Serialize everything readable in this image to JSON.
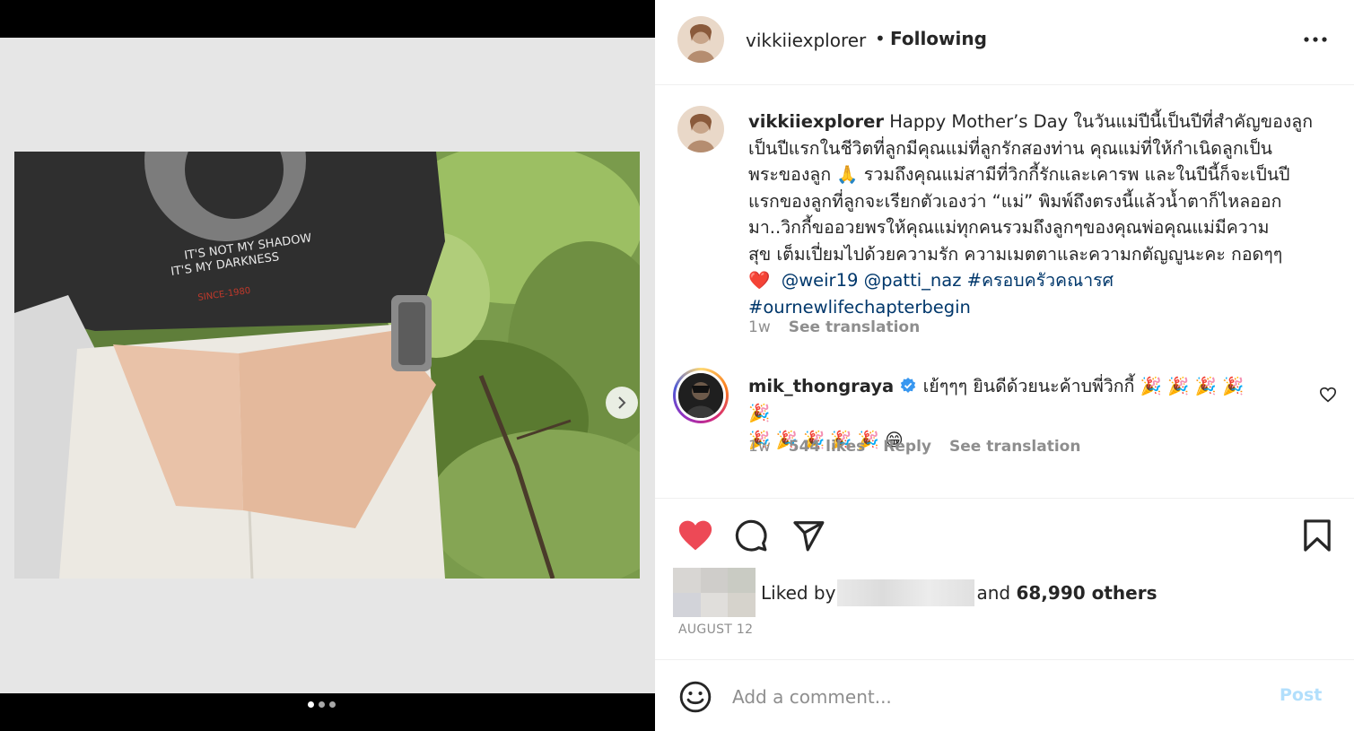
{
  "post": {
    "username": "vikkiiexplorer",
    "separator": "•",
    "follow_status": "Following",
    "more_icon": "more-horizontal-icon"
  },
  "caption": {
    "username": "vikkiiexplorer",
    "lines": [
      "Happy Mother’s Day ในวันแม่ปีนี้เป็นปีที่สำคัญของลูก",
      "เป็นปีแรกในชีวิตที่ลูกมีคุณแม่ที่ลูกรักสองท่าน คุณแม่ที่ให้กำเนิดลูกเป็น",
      "พระของลูก 🙏 รวมถึงคุณแม่สามีที่วิกกี้รักและเคารพ และในปีนี้ก็จะเป็นปี",
      "แรกของลูกที่ลูกจะเรียกตัวเองว่า “แม่” พิมพ์ถึงตรงนี้แล้วน้ำตาก็ไหลออก",
      "มา..วิกกี้ขออวยพรให้คุณแม่ทุกคนรวมถึงลูกๆของคุณพ่อคุณแม่มีความ",
      "สุข เต็มเปี่ยมไปด้วยความรัก ความเมตตาและความกตัญญูนะคะ กอดๆๆ"
    ],
    "heart": "❤️",
    "mentions": [
      "@weir19",
      "@patti_naz",
      "#ครอบครัวคณารศ"
    ],
    "hashtag": "#ournewlifechapterbegin",
    "time": "1w",
    "see_translation": "See translation"
  },
  "comment": {
    "username": "mik_thongraya",
    "text": "เย้ๆๆๆ ยินดีด้วยนะค้าบพี่วิกกี้ 🎉 🎉 🎉 🎉 🎉",
    "text2": "🎉 🎉 🎉 🎉 🎉 😁",
    "time": "1w",
    "likes": "544 likes",
    "reply": "Reply",
    "see_translation": "See translation"
  },
  "likes": {
    "liked_by": "Liked by",
    "and": "and",
    "others": "68,990 others"
  },
  "date": "AUGUST 12",
  "add_comment": {
    "placeholder": "Add a comment...",
    "post_label": "Post"
  },
  "carousel": {
    "slide_count": 3,
    "active_index": 0
  },
  "photo_shirt_text": {
    "line1": "IT'S NOT MY SHADOW",
    "line2": "IT'S MY DARKNESS",
    "line3": "SINCE-1980"
  },
  "colors": {
    "liked_heart": "#ed4956",
    "link": "#00376b",
    "post_disabled": "#b2dffc",
    "secondary_text": "#8e8e8e"
  }
}
